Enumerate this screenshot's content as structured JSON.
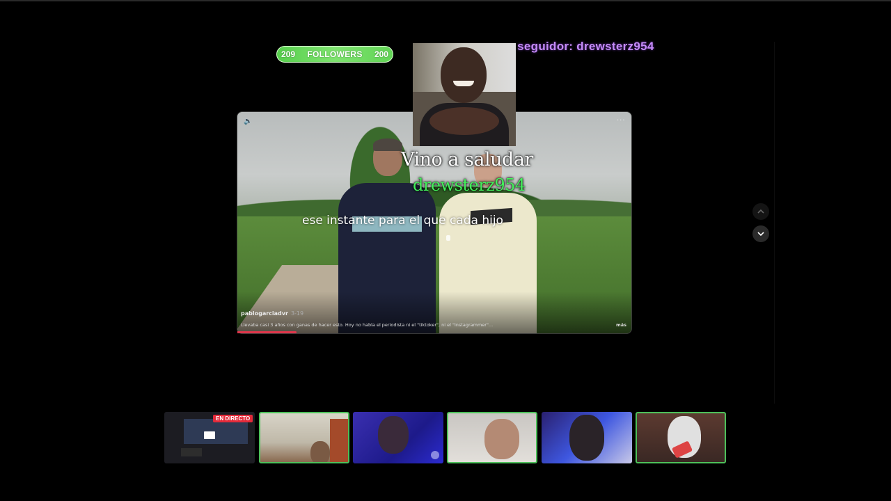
{
  "followers_bar": {
    "current": "209",
    "label": "FOLLOWERS",
    "goal": "200"
  },
  "last_follower": {
    "text": "Último seguidor: drewsterz954",
    "display": "mo seguidor: drewsterz954"
  },
  "alert": {
    "title": "Vino a saludar",
    "username": "drewsterz954"
  },
  "video": {
    "subtitle": "ese instante para el que cada hijo",
    "author": "pablogarciadvr",
    "date": "3-19",
    "caption": "Llevaba casi 3 años con ganas de hacer esto. Hoy no habla el periodista ni el \"tiktoker\", ni el \"instagrammer\"...",
    "more_label": "más",
    "progress": 0.15,
    "accent": "#e0364b"
  },
  "thumbnails": [
    {
      "label": "stream-1",
      "badge": "EN DIRECTO",
      "active": false
    },
    {
      "label": "stream-2",
      "active": true
    },
    {
      "label": "stream-3",
      "active": false
    },
    {
      "label": "stream-4",
      "active": true
    },
    {
      "label": "stream-5",
      "active": false
    },
    {
      "label": "stream-6",
      "active": true
    }
  ],
  "icons": {
    "volume": "volume-icon",
    "more": "more-options-icon",
    "up": "chevron-up-icon",
    "down": "chevron-down-icon"
  },
  "colors": {
    "followers_green": "#58cf4e",
    "ticker_purple": "#c48af7",
    "alert_green": "#43f05b",
    "live_red": "#e42a3a",
    "active_border": "#4dc05a"
  }
}
